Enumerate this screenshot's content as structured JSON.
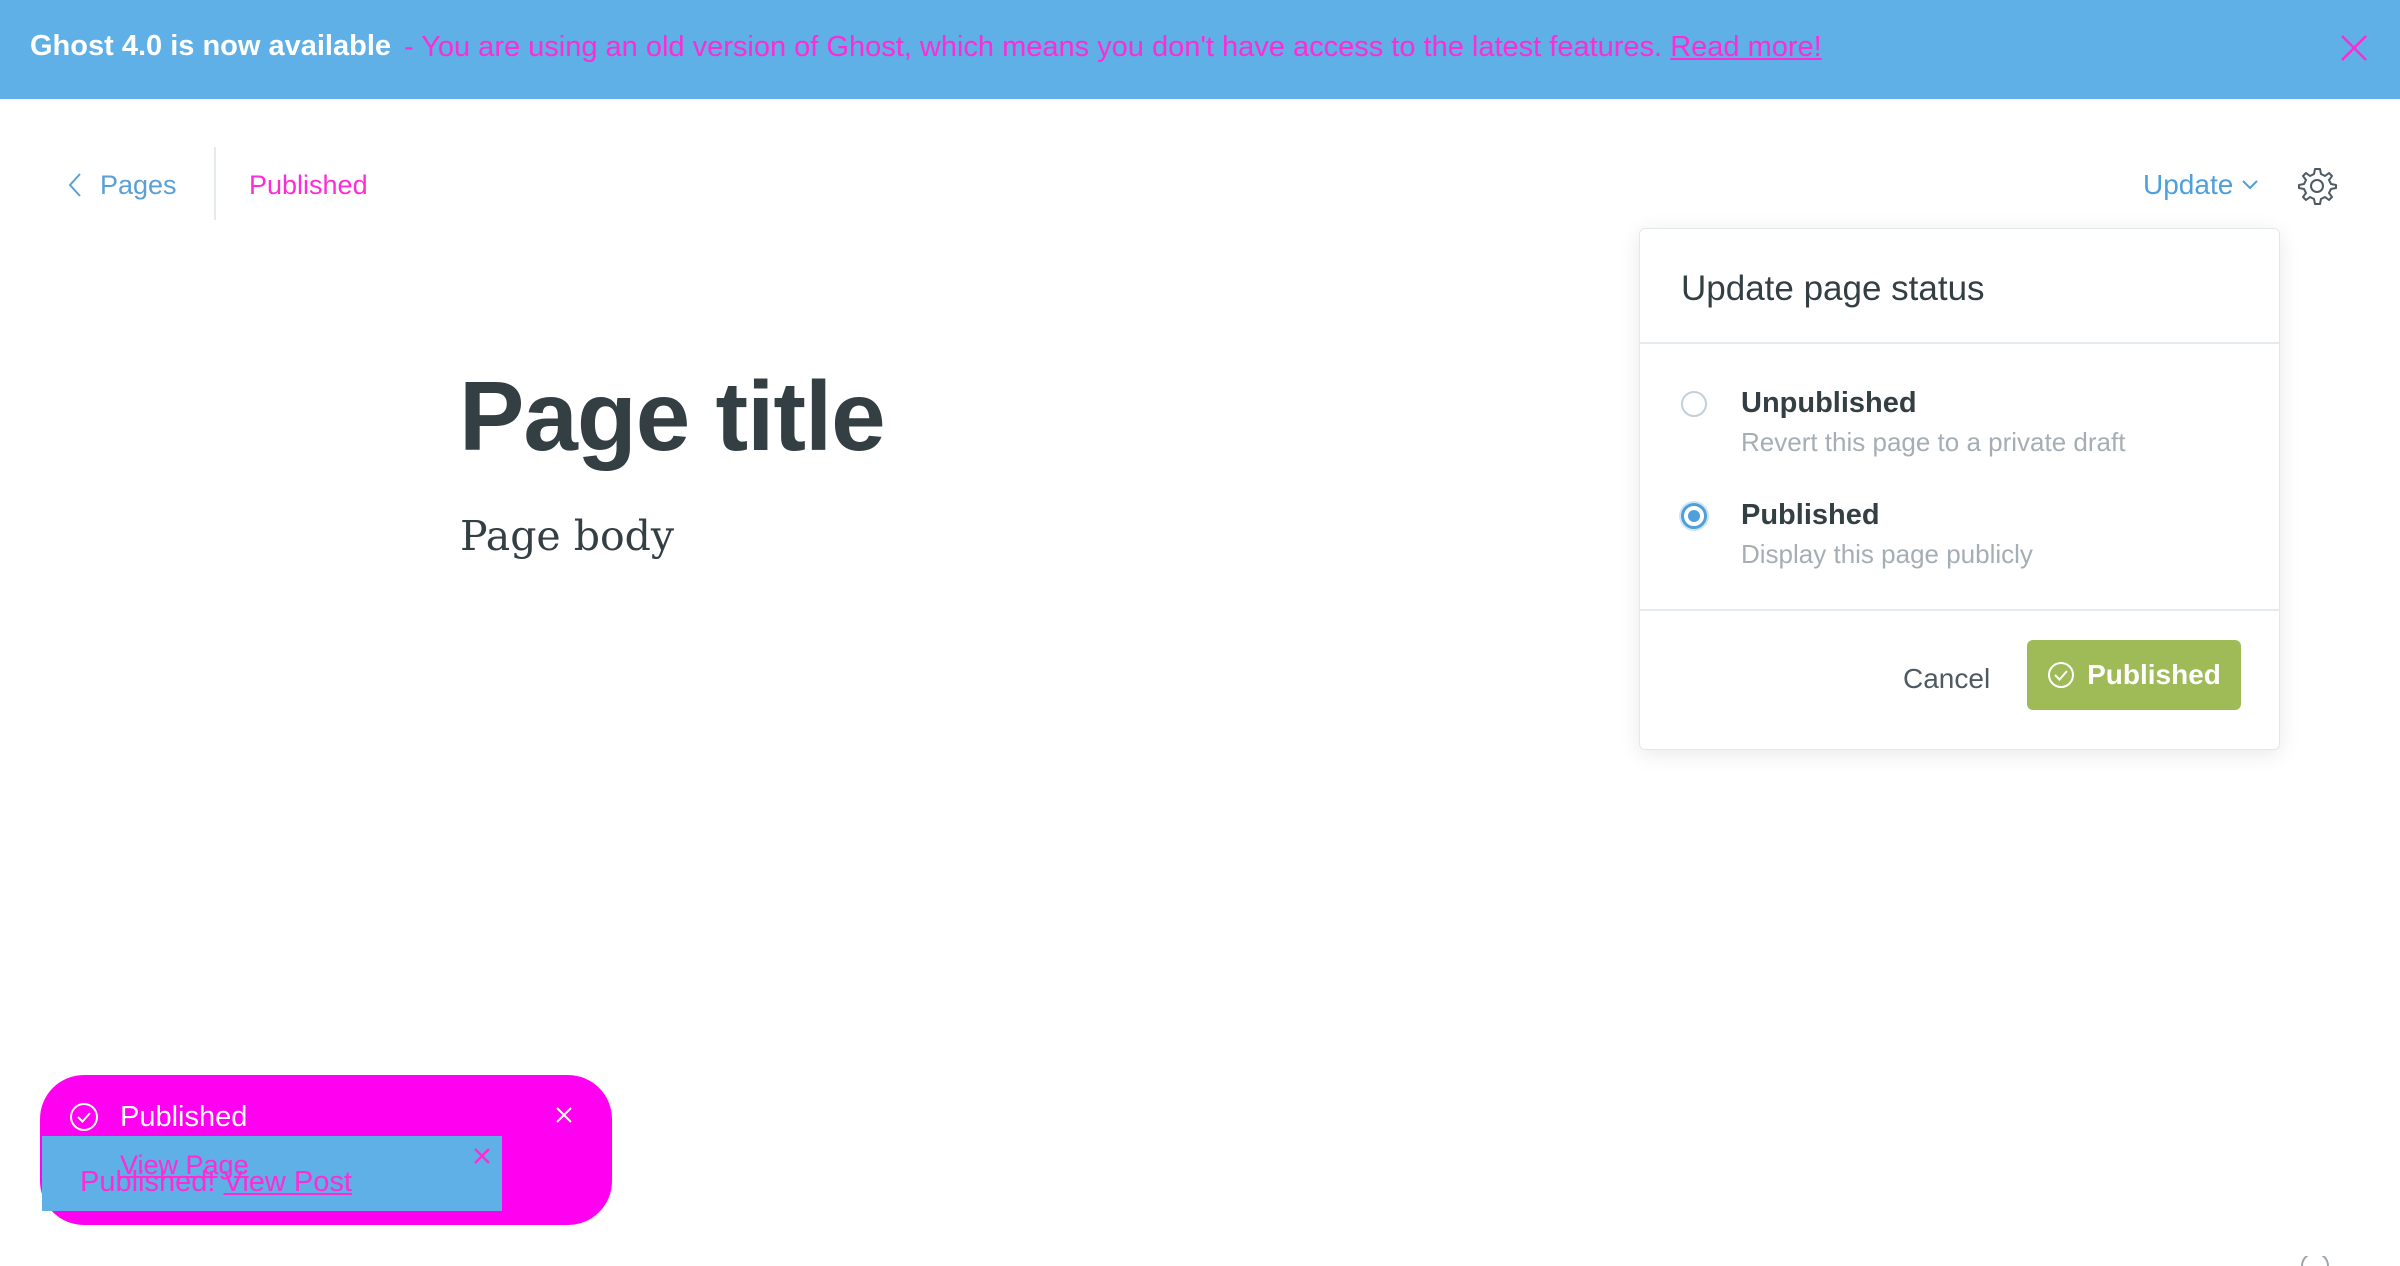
{
  "banner": {
    "title": "Ghost 4.0 is now available",
    "message": "- You are using an old version of Ghost, which means you don't have access to the latest features.",
    "link": "Read more!"
  },
  "header": {
    "back_label": "Pages",
    "status": "Published",
    "update_label": "Update"
  },
  "editor": {
    "title": "Page title",
    "body": "Page body"
  },
  "dropdown": {
    "title": "Update page status",
    "options": [
      {
        "label": "Unpublished",
        "description": "Revert this page to a private draft",
        "selected": false
      },
      {
        "label": "Published",
        "description": "Display this page publicly",
        "selected": true
      }
    ],
    "cancel_label": "Cancel",
    "confirm_label": "Published"
  },
  "notifications": {
    "toast_text": "Published",
    "view_page": "View Page",
    "published_text": "Published!",
    "view_post": "View Post"
  },
  "colors": {
    "banner": "#5fb0e6",
    "accent": "#4f9fdb",
    "confirm": "#9fbb58",
    "overlay_text": "#ff2bd6"
  },
  "icons": {
    "back": "chevron-left-icon",
    "update": "chevron-down-icon",
    "settings": "gear-icon",
    "close": "close-icon",
    "check": "check-circle-icon"
  }
}
